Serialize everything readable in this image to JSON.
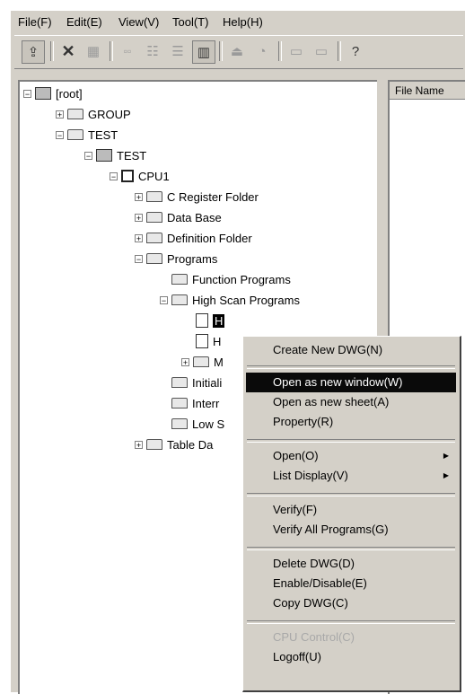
{
  "menubar": [
    "File(F)",
    "Edit(E)",
    "View(V)",
    "Tool(T)",
    "Help(H)"
  ],
  "toolbar": [
    {
      "icon": "up-folder-icon"
    },
    {
      "icon": "delete-icon"
    },
    {
      "icon": "properties-icon"
    },
    {
      "icon": "large-icons-icon"
    },
    {
      "icon": "small-icons-icon"
    },
    {
      "icon": "list-view-icon"
    },
    {
      "icon": "details-view-icon"
    },
    {
      "icon": "import-icon"
    },
    {
      "icon": "export-icon"
    },
    {
      "icon": "link-icon"
    },
    {
      "icon": "unlink-icon"
    },
    {
      "icon": "help-icon"
    }
  ],
  "list": {
    "column": "File Name"
  },
  "tree": [
    {
      "label": "[root]",
      "icon": "network-icon"
    },
    {
      "label": "GROUP",
      "icon": "folder-icon"
    },
    {
      "label": "TEST",
      "icon": "folder-icon"
    },
    {
      "label": "TEST",
      "icon": "controller-icon"
    },
    {
      "label": "CPU1",
      "icon": "cpu-icon"
    },
    {
      "label": "C Register Folder",
      "icon": "folder-icon"
    },
    {
      "label": "Data Base",
      "icon": "folder-icon"
    },
    {
      "label": "Definition Folder",
      "icon": "folder-icon"
    },
    {
      "label": "Programs",
      "icon": "folder-icon"
    },
    {
      "label": "Function Programs",
      "icon": "folder-icon"
    },
    {
      "label": "High Scan Programs",
      "icon": "folder-icon"
    },
    {
      "label": "H",
      "icon": "drawing-icon"
    },
    {
      "label": "H",
      "icon": "drawing-icon"
    },
    {
      "label": "M",
      "icon": "folder-icon"
    },
    {
      "label": "Initiali",
      "icon": "folder-icon"
    },
    {
      "label": "Interr",
      "icon": "folder-icon"
    },
    {
      "label": "Low S",
      "icon": "folder-icon"
    },
    {
      "label": "Table Da",
      "icon": "folder-icon"
    }
  ],
  "context_menu": [
    "Create New DWG(N)",
    "Open as new window(W)",
    "Open as new sheet(A)",
    "Property(R)",
    "Open(O)",
    "List Display(V)",
    "Verify(F)",
    "Verify All Programs(G)",
    "Delete DWG(D)",
    "Enable/Disable(E)",
    "Copy DWG(C)",
    "CPU Control(C)",
    "Logoff(U)"
  ]
}
